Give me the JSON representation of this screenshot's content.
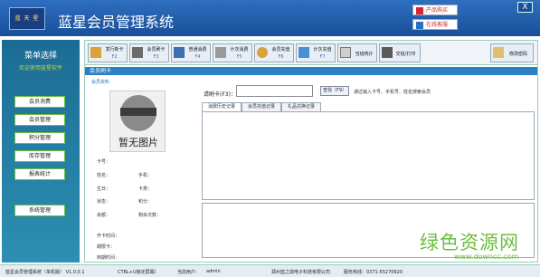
{
  "titlebar": {
    "logo_text": "蓝 天 星",
    "title": "蓝星会员管理系统",
    "buy_label": "产品购买",
    "service_label": "在线客服",
    "close_label": "X"
  },
  "sidebar": {
    "heading": "菜单选择",
    "subtitle": "欢迎使用蓝星软件",
    "items": [
      {
        "label": "会员消费"
      },
      {
        "label": "会员管理"
      },
      {
        "label": "积分管理"
      },
      {
        "label": "库存管理"
      },
      {
        "label": "报表统计"
      },
      {
        "label": "系统管理"
      }
    ]
  },
  "toolbar": {
    "buttons": [
      {
        "label": "发行新卡",
        "key": "F2"
      },
      {
        "label": "会员刷卡",
        "key": "F3"
      },
      {
        "label": "普通消费",
        "key": "F4"
      },
      {
        "label": "计次消费",
        "key": "F5"
      },
      {
        "label": "会员充值",
        "key": "F6"
      },
      {
        "label": "计次充值",
        "key": "F7"
      },
      {
        "label": "当班统计",
        "key": ""
      },
      {
        "label": "交班/打印",
        "key": ""
      },
      {
        "label": "修改密码",
        "key": ""
      }
    ]
  },
  "panel": {
    "title": "会员刷卡",
    "section": "会员资料",
    "photo_text": "暂无图片",
    "fields": {
      "card_no": "卡号：",
      "name": "姓名：",
      "phone": "手机：",
      "birthday": "生日：",
      "card_type": "卡类：",
      "status": "状态：",
      "points": "积分：",
      "balance": "余额：",
      "remaining_times": "剩余次数：",
      "open_time": "开卡时间：",
      "expire_time": "期限卡：",
      "due_time": "到期时间："
    },
    "card_label": "请刷卡(F3)：",
    "card_value": "",
    "find_label": "查找（F9）",
    "hint": "通过输入卡号、手机号、姓名搜索会员",
    "tabs": [
      {
        "label": "消费历史记录"
      },
      {
        "label": "会员充值记录"
      },
      {
        "label": "礼品兑换记录"
      }
    ]
  },
  "statusbar": {
    "app": "蓝星会员管理系统（单机版） V1.0.0.1",
    "ctrl": "CTRL+U锁定屏幕）",
    "user_label": "当前用户:",
    "user": "admin",
    "company": "郑州蓝之鼎电子科技有限公司",
    "phone": "服务热线：0371-55270920"
  },
  "watermark": {
    "text": "绿色资源网",
    "url": "www.downcc.com"
  },
  "colors": {
    "title_bg": "#1a4f99",
    "sidebar_bg": "#1b6c93",
    "accent": "#2b7fc4",
    "sidebar_btn_border": "#6cbf3a"
  }
}
